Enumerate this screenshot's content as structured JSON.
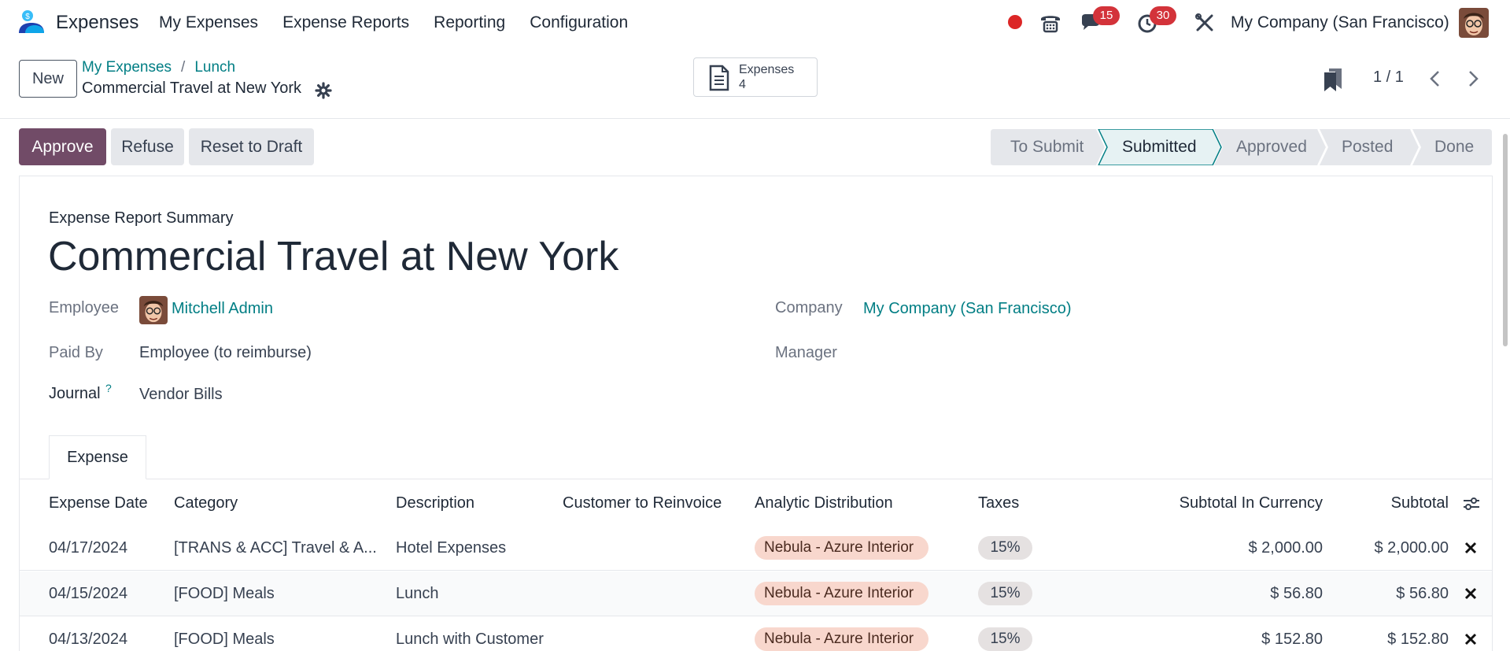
{
  "navbar": {
    "app_name": "Expenses",
    "menu": [
      "My Expenses",
      "Expense Reports",
      "Reporting",
      "Configuration"
    ],
    "messages_count": "15",
    "activities_count": "30",
    "company": "My Company (San Francisco)"
  },
  "control": {
    "new_label": "New",
    "breadcrumb": [
      "My Expenses",
      "Lunch"
    ],
    "record_title": "Commercial Travel at New York",
    "smart_button": {
      "label": "Expenses",
      "count": "4"
    },
    "pager": "1 / 1"
  },
  "status": {
    "buttons": {
      "approve": "Approve",
      "refuse": "Refuse",
      "reset": "Reset to Draft"
    },
    "stages": [
      "To Submit",
      "Submitted",
      "Approved",
      "Posted",
      "Done"
    ],
    "current_stage": "Submitted"
  },
  "form": {
    "subtitle": "Expense Report Summary",
    "title": "Commercial Travel at New York",
    "employee_label": "Employee",
    "employee_value": "Mitchell Admin",
    "paid_by_label": "Paid By",
    "paid_by_value": "Employee (to reimburse)",
    "journal_label": "Journal",
    "journal_help": "?",
    "journal_value": "Vendor Bills",
    "company_label": "Company",
    "company_value": "My Company (San Francisco)",
    "manager_label": "Manager"
  },
  "tabs": [
    "Expense"
  ],
  "table": {
    "columns": [
      "Expense Date",
      "Category",
      "Description",
      "Customer to Reinvoice",
      "Analytic Distribution",
      "Taxes",
      "Subtotal In Currency",
      "Subtotal"
    ],
    "rows": [
      {
        "date": "04/17/2024",
        "category": "[TRANS & ACC] Travel & A...",
        "description": "Hotel Expenses",
        "customer": "",
        "analytic": "Nebula - Azure Interior",
        "taxes": "15%",
        "subtotal_currency": "$ 2,000.00",
        "subtotal": "$ 2,000.00"
      },
      {
        "date": "04/15/2024",
        "category": "[FOOD] Meals",
        "description": "Lunch",
        "customer": "",
        "analytic": "Nebula - Azure Interior",
        "taxes": "15%",
        "subtotal_currency": "$ 56.80",
        "subtotal": "$ 56.80"
      },
      {
        "date": "04/13/2024",
        "category": "[FOOD] Meals",
        "description": "Lunch with Customer",
        "customer": "",
        "analytic": "Nebula - Azure Interior",
        "taxes": "15%",
        "subtotal_currency": "$ 152.80",
        "subtotal": "$ 152.80"
      }
    ]
  },
  "colors": {
    "primary": "#714b67",
    "link": "#017e84",
    "badge": "#d3333a",
    "analytic_tag": "#f8d7cd"
  }
}
